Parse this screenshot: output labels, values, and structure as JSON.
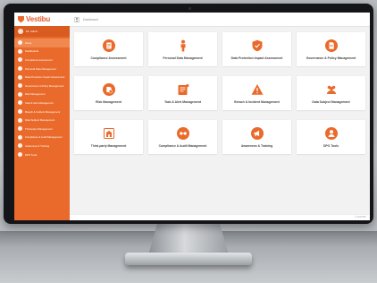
{
  "app": {
    "name": "Vestibu",
    "brand_color": "#ea6a2b"
  },
  "header": {
    "breadcrumb": "Dashboard",
    "menu_icon": "hamburger-icon"
  },
  "user": {
    "name": "Mr. Admin",
    "avatar_icon": "user-avatar-icon"
  },
  "sidebar": {
    "items": [
      {
        "label": "Home",
        "icon": "home-icon",
        "active": true
      },
      {
        "label": "Dashboards",
        "icon": "dashboard-icon"
      },
      {
        "label": "Compliance Assessment",
        "icon": "clipboard-icon"
      },
      {
        "label": "Personal Data Management",
        "icon": "person-icon"
      },
      {
        "label": "Data Protection Impact Assessment",
        "icon": "shield-icon"
      },
      {
        "label": "Governance & Policy Management",
        "icon": "document-icon"
      },
      {
        "label": "Risk Management",
        "icon": "risk-icon"
      },
      {
        "label": "Task & Alert Management",
        "icon": "bell-icon"
      },
      {
        "label": "Breach & Incident Management",
        "icon": "warning-icon"
      },
      {
        "label": "Data Subject Management",
        "icon": "users-icon"
      },
      {
        "label": "Third-party Management",
        "icon": "building-icon"
      },
      {
        "label": "Compliance & Audit Management",
        "icon": "eye-icon"
      },
      {
        "label": "Awareness & Training",
        "icon": "megaphone-icon"
      },
      {
        "label": "DPO Tools",
        "icon": "tools-icon"
      }
    ]
  },
  "cards": [
    {
      "label": "Compliance Assessment",
      "icon": "clipboard-icon"
    },
    {
      "label": "Personal Data Management",
      "icon": "person-icon"
    },
    {
      "label": "Data Protection Impact Assessment",
      "icon": "shield-check-icon"
    },
    {
      "label": "Governance & Policy Management",
      "icon": "document-icon"
    },
    {
      "label": "Risk Management",
      "icon": "risk-icon"
    },
    {
      "label": "Task & Alert Management",
      "icon": "task-alert-icon"
    },
    {
      "label": "Breach & Incident Management",
      "icon": "warning-icon"
    },
    {
      "label": "Data Subject Management",
      "icon": "users-icon"
    },
    {
      "label": "Third-party Management",
      "icon": "building-icon"
    },
    {
      "label": "Compliance & Audit Management",
      "icon": "eye-icon"
    },
    {
      "label": "Awareness & Training",
      "icon": "megaphone-icon"
    },
    {
      "label": "DPO Tools",
      "icon": "dpo-icon"
    }
  ],
  "footer": {
    "text": "© VESTIBU"
  }
}
